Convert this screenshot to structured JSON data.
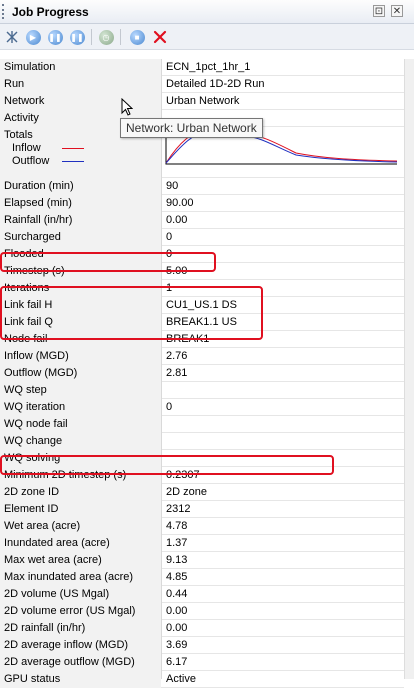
{
  "window": {
    "title": "Job Progress",
    "pin_glyph": "⊡",
    "close_glyph": "✕"
  },
  "toolbar": {
    "icons": [
      "settings-icon",
      "play-icon",
      "pause-icon",
      "pause-all-icon",
      "timer-icon",
      "stop-icon",
      "cancel-icon"
    ],
    "accent": "#4a88d0",
    "cancel_color": "#e01020"
  },
  "properties": [
    {
      "label": "Simulation",
      "value": "ECN_1pct_1hr_1"
    },
    {
      "label": "Run",
      "value": "Detailed 1D-2D Run"
    },
    {
      "label": "Network",
      "value": "Urban Network"
    },
    {
      "label": "Activity",
      "value": ""
    },
    {
      "label": "Totals",
      "value": "",
      "legend": [
        {
          "name": "Inflow",
          "color": "#e01020"
        },
        {
          "name": "Outflow",
          "color": "#2030c0"
        }
      ]
    },
    {
      "label": "Duration (min)",
      "value": "90"
    },
    {
      "label": "Elapsed (min)",
      "value": "90.00"
    },
    {
      "label": "Rainfall (in/hr)",
      "value": "0.00"
    },
    {
      "label": "Surcharged",
      "value": "0"
    },
    {
      "label": "Flooded",
      "value": "0"
    },
    {
      "label": "Timestep (s)",
      "value": "5.00"
    },
    {
      "label": "Iterations",
      "value": "1"
    },
    {
      "label": "Link fail H",
      "value": "CU1_US.1 DS"
    },
    {
      "label": "Link fail Q",
      "value": "BREAK1.1 US"
    },
    {
      "label": "Node fail",
      "value": "BREAK1"
    },
    {
      "label": "Inflow (MGD)",
      "value": "2.76"
    },
    {
      "label": "Outflow (MGD)",
      "value": "2.81"
    },
    {
      "label": "WQ step",
      "value": ""
    },
    {
      "label": "WQ iteration",
      "value": "0"
    },
    {
      "label": "WQ node fail",
      "value": ""
    },
    {
      "label": "WQ change",
      "value": ""
    },
    {
      "label": "WQ solving",
      "value": ""
    },
    {
      "label": "Minimum 2D timestep (s)",
      "value": "0.2307"
    },
    {
      "label": "2D zone ID",
      "value": "2D zone"
    },
    {
      "label": "Element ID",
      "value": "2312"
    },
    {
      "label": "Wet area (acre)",
      "value": "4.78"
    },
    {
      "label": "Inundated area (acre)",
      "value": "1.37"
    },
    {
      "label": "Max wet area (acre)",
      "value": "9.13"
    },
    {
      "label": "Max inundated area (acre)",
      "value": "4.85"
    },
    {
      "label": "2D volume (US Mgal)",
      "value": "0.44"
    },
    {
      "label": "2D volume error (US Mgal)",
      "value": "0.00"
    },
    {
      "label": "2D rainfall (in/hr)",
      "value": "0.00"
    },
    {
      "label": "2D average inflow (MGD)",
      "value": "3.69"
    },
    {
      "label": "2D average outflow (MGD)",
      "value": "6.17"
    },
    {
      "label": "GPU status",
      "value": "Active"
    }
  ],
  "tooltip": {
    "text": "Network: Urban Network"
  },
  "highlight_color": "#e01020"
}
